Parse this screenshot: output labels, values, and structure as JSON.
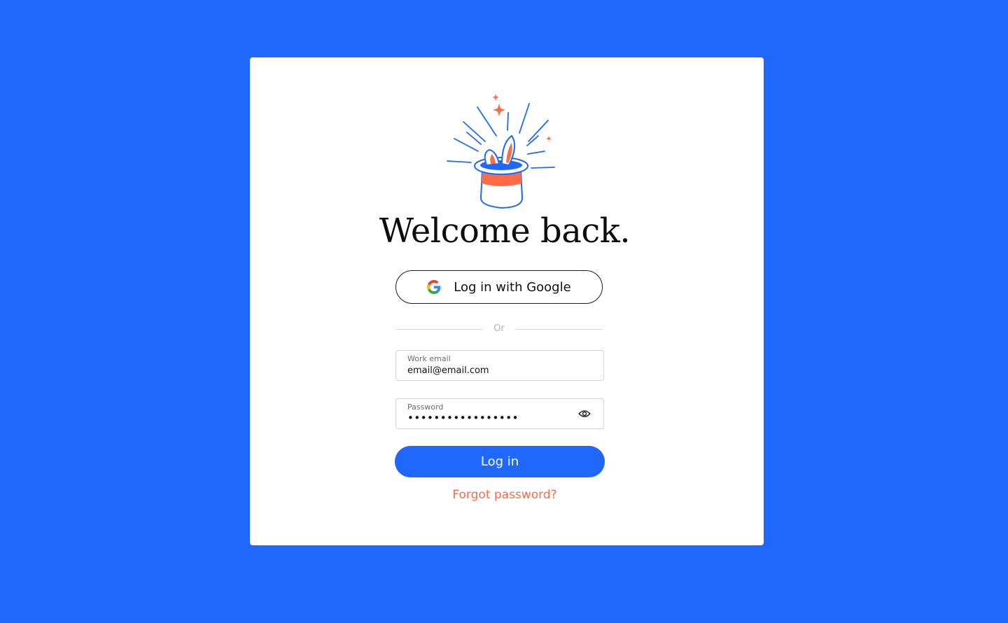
{
  "login": {
    "title": "Welcome back.",
    "google_button_label": "Log in with Google",
    "divider_text": "Or",
    "email_label": "Work email",
    "email_value": "email@email.com",
    "password_label": "Password",
    "password_value": "•••••••••••••••••",
    "login_button_label": "Log in",
    "forgot_password_label": "Forgot password?"
  },
  "icons": {
    "illustration": "magic-hat-rabbit-icon",
    "google": "google-icon",
    "password_toggle": "eye-icon"
  },
  "colors": {
    "background": "#1f68fb",
    "primary": "#1f68fb",
    "accent": "#ff6b47",
    "card": "#ffffff"
  }
}
